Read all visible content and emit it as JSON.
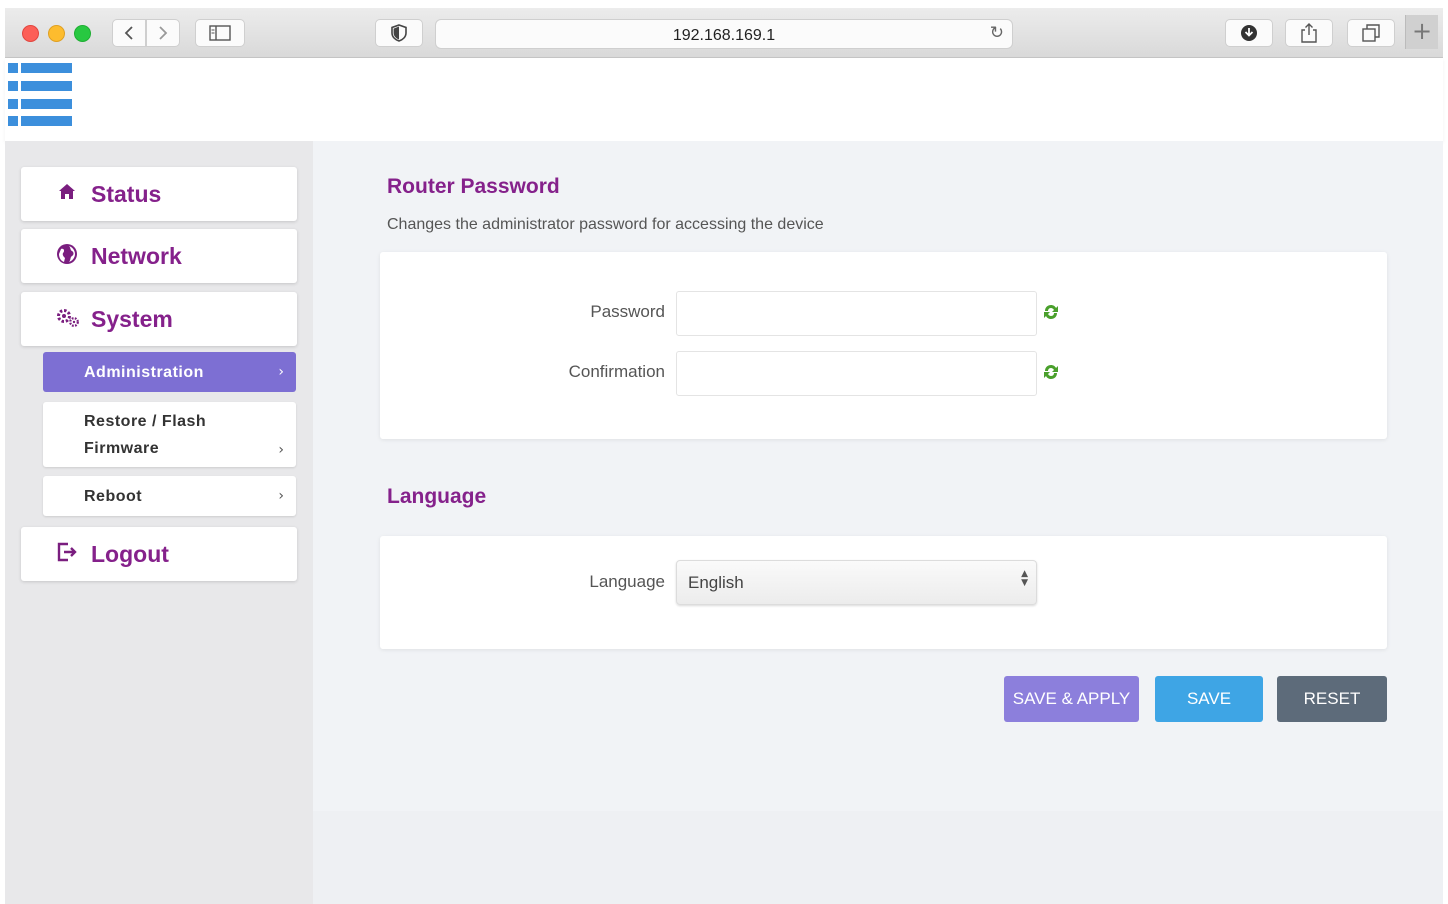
{
  "browser": {
    "url": "192.168.169.1",
    "icons": {
      "back": "chevron-left-icon",
      "forward": "chevron-right-icon",
      "sidebar": "sidebar-icon",
      "shield": "shield-icon",
      "reload": "reload-icon",
      "download": "download-icon",
      "share": "share-icon",
      "tabs": "tabs-icon",
      "new_tab": "plus-icon"
    },
    "new_tab_label": "+"
  },
  "header": {
    "menu_icon": "hamburger-menu-icon",
    "accent_color": "#3c8fdc"
  },
  "sidebar": {
    "items": [
      {
        "label": "Status",
        "icon": "home-icon"
      },
      {
        "label": "Network",
        "icon": "globe-icon"
      },
      {
        "label": "System",
        "icon": "gears-icon"
      },
      {
        "label": "Logout",
        "icon": "logout-icon"
      }
    ],
    "submenu": [
      {
        "label": "Administration",
        "active": true
      },
      {
        "label_line1": "Restore / Flash",
        "label_line2": "Firmware",
        "active": false
      },
      {
        "label": "Reboot",
        "active": false
      }
    ],
    "chevron": "›"
  },
  "router_password": {
    "title": "Router Password",
    "description": "Changes the administrator password for accessing the device",
    "password_label": "Password",
    "password_value": "",
    "confirmation_label": "Confirmation",
    "confirmation_value": "",
    "generate_icon": "refresh-arrows-icon"
  },
  "language": {
    "title": "Language",
    "label": "Language",
    "selected": "English"
  },
  "actions": {
    "save_apply": "SAVE & APPLY",
    "save": "SAVE",
    "reset": "RESET"
  },
  "colors": {
    "brand_purple": "#85218b",
    "active_submenu": "#7d6fd3",
    "save_apply": "#8c7fdc",
    "save": "#3ea5e5",
    "reset": "#5d6b7a"
  }
}
